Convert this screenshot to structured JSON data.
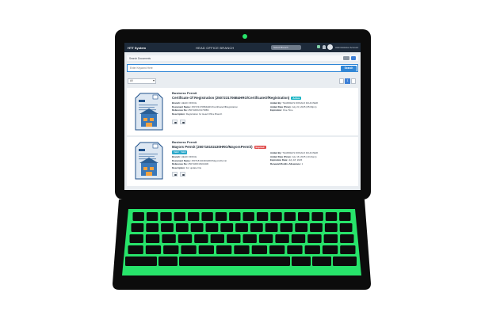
{
  "colors": {
    "frame": "#0c0c0c",
    "accent": "#27e36a",
    "header": "#1d2a3a",
    "primary": "#2f86d6",
    "badge_teal": "#17b4c4",
    "badge_red": "#e04a4a"
  },
  "app": {
    "logo": "HTT System",
    "branch_title": "HEAD OFFICE BRANCH",
    "branch_select": "Select Branch",
    "user_name": "Administrator Account"
  },
  "topbar": {
    "label": "Search Documents",
    "grid_toggle_icon": "grid-icon",
    "list_toggle_icon": "list-icon"
  },
  "search": {
    "placeholder": "Enter Keyword Here",
    "button_label": "Search"
  },
  "filter": {
    "value": "All"
  },
  "pager": {
    "page": "1"
  },
  "documents": [
    {
      "category": "Business Permit",
      "title": "Certificate Of Registration (2507231706B4HRO/CertificateOfRegistration)",
      "badge": "Active",
      "left_meta": [
        {
          "label": "Branch:",
          "value": "HEAD OFFICE"
        },
        {
          "label": "Document Name:",
          "value": "2507231706B4HRO/CertificateOfRegistration"
        },
        {
          "label": "Reference No:",
          "value": "2507HRO231706B4"
        },
        {
          "label": "Description:",
          "value": "Registration for Head Office Branch"
        }
      ],
      "right_meta": [
        {
          "label": "Added By:",
          "value": "THADDEUS DONALD FAULKNER"
        },
        {
          "label": "Added Date (Time):",
          "value": "July 23, 2025 (05:09pm)"
        },
        {
          "label": "Expiration:",
          "value": "One-Time"
        }
      ]
    },
    {
      "category": "Business Permit",
      "title": "Mayors Permit (250718102430HRO/MayorsPermit)",
      "badge": "Expired",
      "chips": [
        "Valid",
        "Valid"
      ],
      "left_meta": [
        {
          "label": "Branch:",
          "value": "HEAD OFFICE"
        },
        {
          "label": "Document Name:",
          "value": "250718102430HRO/MayorsPermit"
        },
        {
          "label": "Reference No:",
          "value": "2507HRO18102430"
        },
        {
          "label": "Description:",
          "value": "For update File"
        }
      ],
      "right_meta": [
        {
          "label": "Added By:",
          "value": "THADDEUS DONALD FAULKNER"
        },
        {
          "label": "Added Date (Time):",
          "value": "July 18, 2025 (10:24am)"
        },
        {
          "label": "Expiration Date:",
          "value": "July 18, 2026"
        },
        {
          "label": "Renewal Months Allowance:",
          "value": "1"
        }
      ]
    }
  ]
}
